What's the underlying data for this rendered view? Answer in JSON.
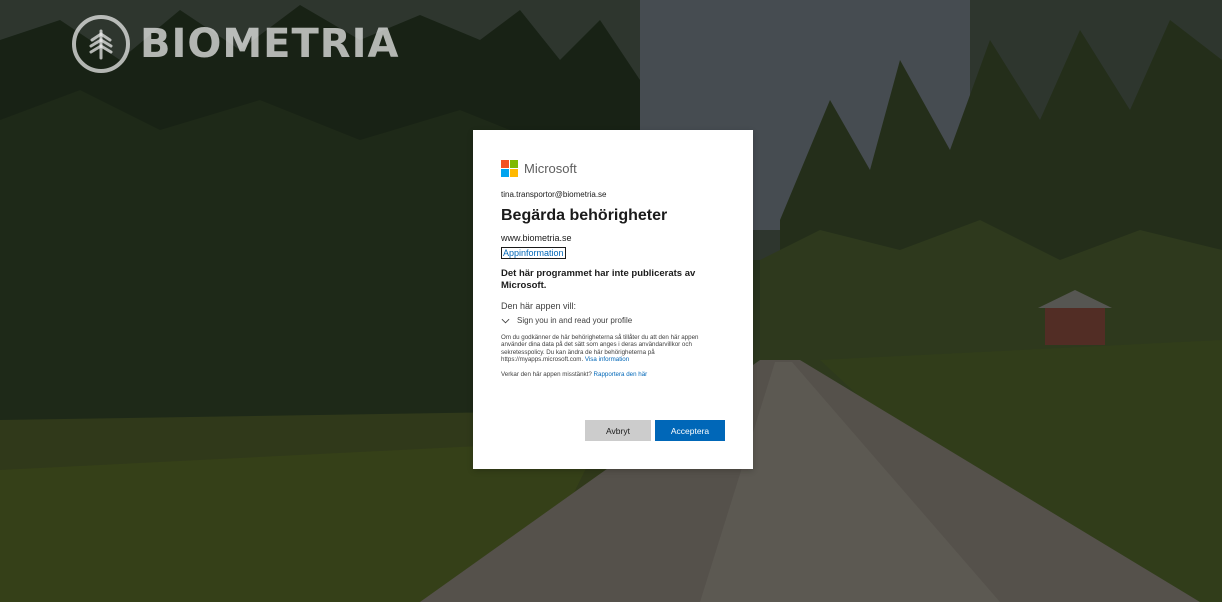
{
  "brand": {
    "logo_text": "BIOMETRIA"
  },
  "dialog": {
    "ms_brand": "Microsoft",
    "account": "tina.transportor@biometria.se",
    "title": "Begärda behörigheter",
    "site": "www.biometria.se",
    "app_info_link": "Appinformation",
    "not_published": "Det här programmet har inte publicerats av Microsoft.",
    "app_wants": "Den här appen vill:",
    "permissions": [
      {
        "label": "Sign you in and read your profile",
        "icon": "chevron-down-icon"
      }
    ],
    "consent_text": "Om du godkänner de här behörigheterna så tillåter du att den här appen använder dina data på det sätt som anges i deras användarvillkor och sekretesspolicy. Du kan ändra de här behörigheterna på https://myapps.microsoft.com.",
    "consent_link": "Visa information",
    "suspicious_text": "Verkar den här appen misstänkt?",
    "report_link": "Rapportera den här",
    "cancel_button": "Avbryt",
    "accept_button": "Acceptera"
  },
  "colors": {
    "accent": "#0067b8",
    "ms_red": "#f25022",
    "ms_green": "#7fba00",
    "ms_blue": "#00a4ef",
    "ms_yellow": "#ffb900",
    "cancel_bg": "#cccccc"
  }
}
